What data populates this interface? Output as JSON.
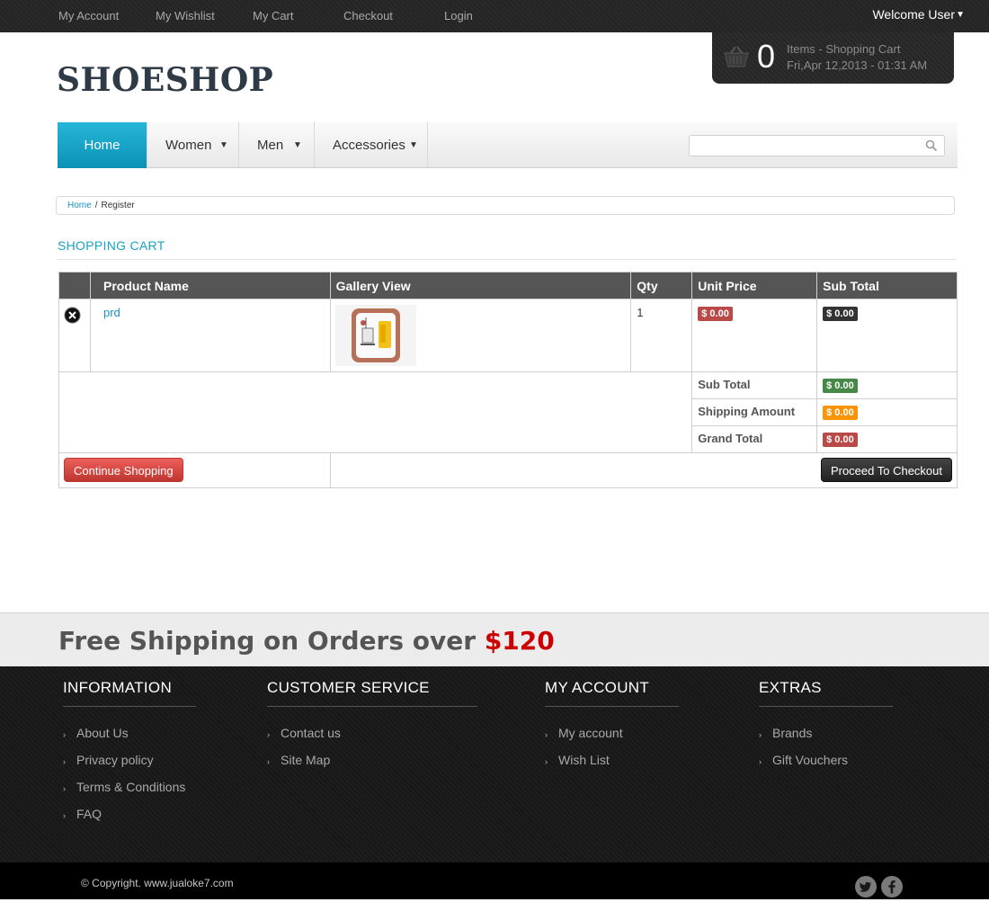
{
  "topnav": {
    "links": [
      "My Account",
      "My Wishlist",
      "My Cart",
      "Checkout",
      "Login"
    ],
    "welcome": "Welcome User"
  },
  "cart_widget": {
    "count": "0",
    "label": "Items - Shopping Cart",
    "datetime": "Fri,Apr 12,2013 - 01:31 AM"
  },
  "logo": "SHOESHOP",
  "mainnav": {
    "items": [
      "Home",
      "Women",
      "Men",
      "Accessories"
    ],
    "search_placeholder": ""
  },
  "breadcrumb": {
    "home": "Home",
    "sep": "/",
    "current": "Register"
  },
  "section_title": "SHOPPING CART",
  "cart_table": {
    "headers": [
      "",
      "Product Name",
      "Gallery View",
      "Qty",
      "Unit Price",
      "Sub Total"
    ],
    "rows": [
      {
        "product": "prd",
        "qty": "1",
        "unit_price": "$ 0.00",
        "sub_total": "$ 0.00"
      }
    ],
    "summary": {
      "sub_total_label": "Sub Total",
      "sub_total_value": "$ 0.00",
      "shipping_label": "Shipping Amount",
      "shipping_value": "$ 0.00",
      "grand_total_label": "Grand Total",
      "grand_total_value": "$ 0.00"
    },
    "continue_label": "Continue Shopping",
    "checkout_label": "Proceed To Checkout"
  },
  "shipping_banner": {
    "text": "Free Shipping on Orders over",
    "amount": "$120"
  },
  "footer": {
    "columns": [
      {
        "title": "INFORMATION",
        "items": [
          "About Us",
          "Privacy policy",
          "Terms & Conditions",
          "FAQ"
        ]
      },
      {
        "title": "CUSTOMER SERVICE",
        "items": [
          "Contact us",
          "Site Map"
        ]
      },
      {
        "title": "MY ACCOUNT",
        "items": [
          "My account",
          "Wish List"
        ]
      },
      {
        "title": "EXTRAS",
        "items": [
          "Brands",
          "Gift Vouchers"
        ]
      }
    ],
    "copyright": "© Copyright. www.jualoke7.com"
  },
  "icons": {
    "basket": "basket-icon",
    "search": "search-icon",
    "remove": "remove-icon",
    "twitter": "twitter-icon",
    "facebook": "facebook-icon"
  },
  "colors": {
    "accent": "#1aa0c7",
    "nav_active": "#0a91b6",
    "price_red": "#b94a48",
    "total_green": "#468847",
    "shipping_orange": "#f89406",
    "banner_amount": "#cc0000"
  }
}
